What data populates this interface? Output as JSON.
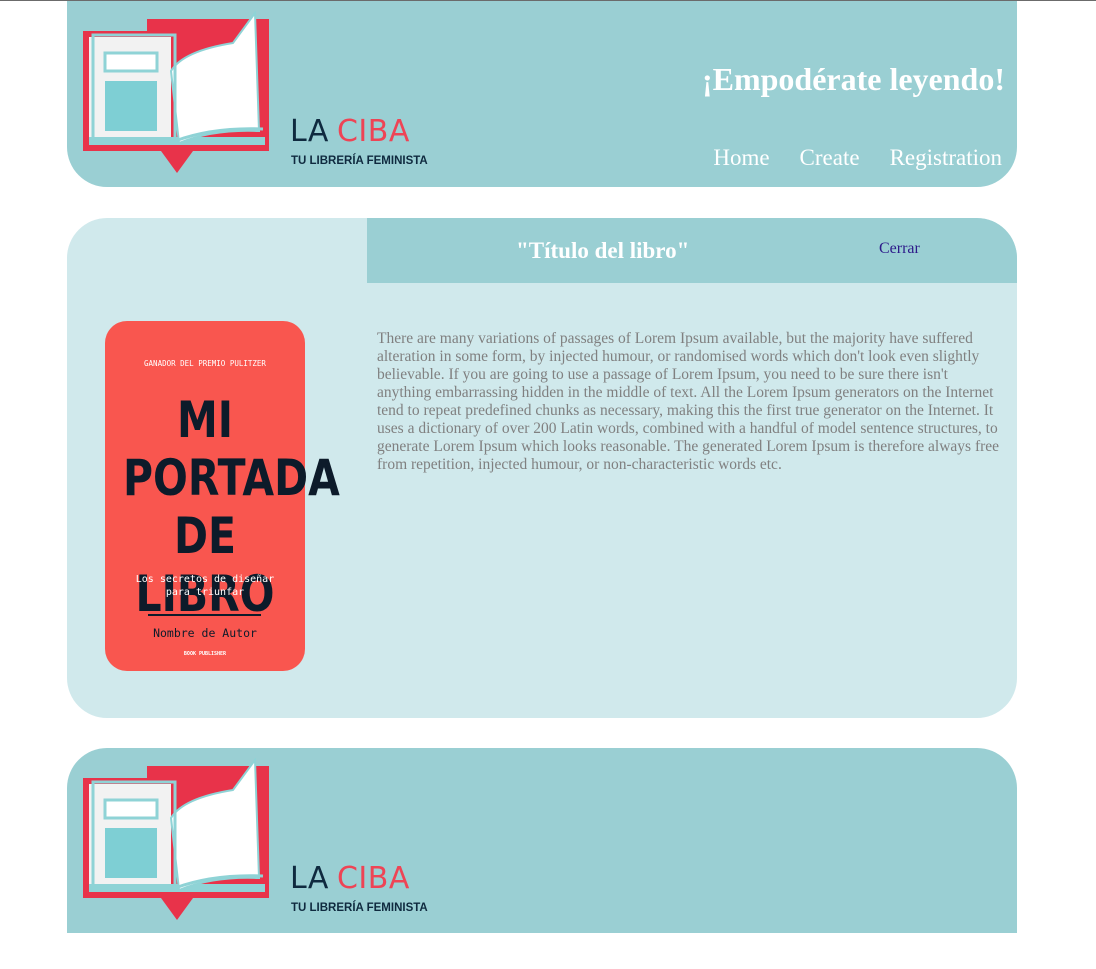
{
  "header": {
    "brand_la": "LA",
    "brand_ciba": "CIBA",
    "tagline": "TU LIBRERÍA FEMINISTA",
    "headline": "¡Empodérate leyendo!",
    "nav": [
      "Home",
      "Create",
      "Registration"
    ]
  },
  "book": {
    "title": "\"Título del libro\"",
    "close_label": "Cerrar",
    "description": "There are many variations of passages of Lorem Ipsum available, but the majority have suffered alteration in some form, by injected humour, or randomised words which don't look even slightly believable. If you are going to use a passage of Lorem Ipsum, you need to be sure there isn't anything embarrassing hidden in the middle of text. All the Lorem Ipsum generators on the Internet tend to repeat predefined chunks as necessary, making this the first true generator on the Internet. It uses a dictionary of over 200 Latin words, combined with a handful of model sentence structures, to generate Lorem Ipsum which looks reasonable. The generated Lorem Ipsum is therefore always free from repetition, injected humour, or non-characteristic words etc.",
    "cover": {
      "award": "GANADOR DEL PREMIO PULITZER",
      "line1": "MI",
      "line2": "PORTADA",
      "line3": "DE LIBRO",
      "subtitle": "Los secretos de diseñar\npara triunfar",
      "author": "Nombre de Autor",
      "publisher": "BOOK PUBLISHER"
    }
  },
  "footer": {
    "brand_la": "LA",
    "brand_ciba": "CIBA",
    "tagline": "TU LIBRERÍA FEMINISTA"
  },
  "colors": {
    "header_bg": "#9acfd3",
    "panel_bg": "#d0e9ec",
    "accent_red": "#ee4455",
    "cover_red": "#f9564f",
    "navy": "#0f2a3f"
  },
  "icons": [
    "book-logo-icon"
  ]
}
